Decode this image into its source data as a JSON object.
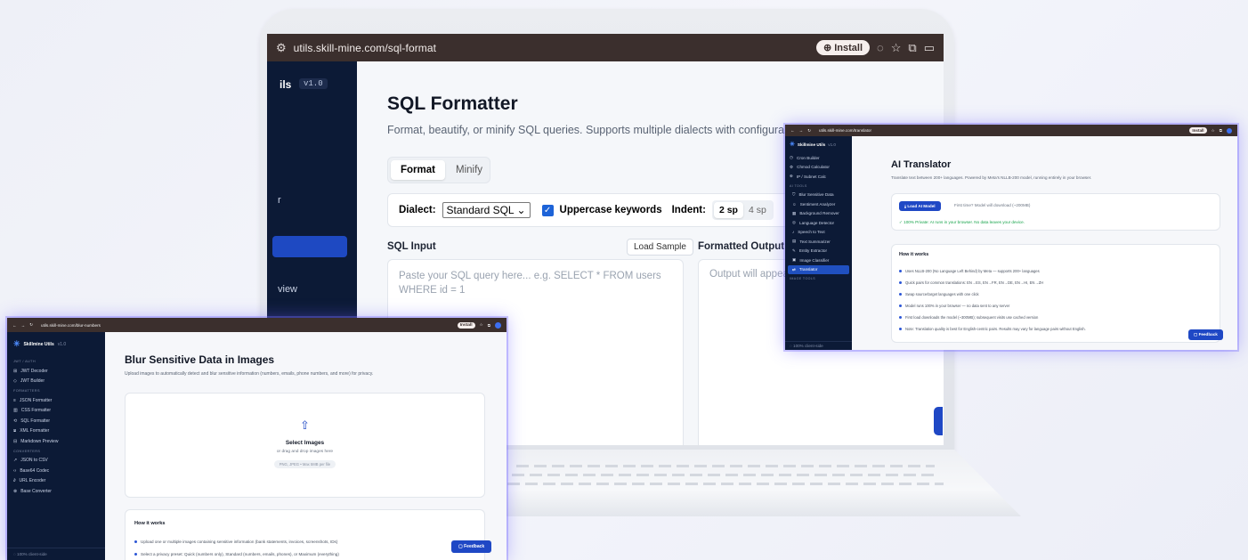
{
  "sql_screen": {
    "url": "utils.skill-mine.com/sql-format",
    "install_label": "Install",
    "version_badge": "v1.0",
    "brand_tail": "ils",
    "sidebar_partial": [
      "r",
      "view"
    ],
    "title": "SQL Formatter",
    "subtitle": "Format, beautify, or minify SQL queries. Supports multiple dialects with configurable key",
    "tabs": [
      "Format",
      "Minify"
    ],
    "dialect_label": "Dialect:",
    "dialect_value": "Standard SQL",
    "uppercase_label": "Uppercase keywords",
    "indent_label": "Indent:",
    "indent_options": [
      "2 sp",
      "4 sp"
    ],
    "input_label": "SQL Input",
    "load_sample_label": "Load Sample",
    "output_label": "Formatted Output",
    "input_placeholder": "Paste your SQL query here... e.g. SELECT * FROM users WHERE id = 1",
    "output_placeholder": "Output will appea"
  },
  "translator": {
    "url": "utils.skill-mine.com/translator",
    "install_label": "Install",
    "brand": "Skillmine Utils",
    "version": "v1.0",
    "sidebar_items_top": [
      "Cron Builder",
      "Chmod Calculator",
      "IP / Subnet Calc"
    ],
    "group_ai": "AI TOOLS",
    "ai_items": [
      "Blur Sensitive Data",
      "Sentiment Analyzer",
      "Background Remover",
      "Language Detector",
      "Speech to Text",
      "Text Summarizer",
      "Entity Extractor",
      "Image Classifier",
      "Translator"
    ],
    "group_image": "IMAGE TOOLS",
    "footer": "100% client-side",
    "title": "AI Translator",
    "subtitle": "Translate text between 200+ languages. Powered by Meta's NLLB-200 model, running entirely in your browser.",
    "load_button": "Load AI Model",
    "load_hint": "First time? Model will download (~200MB)",
    "privacy_note": "100% Private: AI runs in your browser. No data leaves your device.",
    "how_title": "How it works",
    "how_items": [
      "Uses NLLB-200 (No Language Left Behind) by Meta — supports 200+ languages",
      "Quick pairs for common translations: EN→ES, EN→FR, EN→DE, EN→HI, EN→ZH",
      "Swap source/target languages with one click",
      "Model runs 100% in your browser — no data sent to any server",
      "First load downloads the model (~300MB); subsequent visits use cached version",
      "Note: Translation quality is best for English-centric pairs. Results may vary for language pairs without English."
    ],
    "feedback": "Feedback"
  },
  "blur": {
    "url": "utils.skill-mine.com/blur-numbers",
    "install_label": "Install",
    "brand": "Skillmine Utils",
    "version": "v1.0",
    "groups": [
      {
        "name": "JWT / AUTH",
        "items": [
          "JWT Decoder",
          "JWT Builder"
        ]
      },
      {
        "name": "FORMATTERS",
        "items": [
          "JSON Formatter",
          "CSS Formatter",
          "SQL Formatter",
          "XML Formatter",
          "Markdown Preview"
        ]
      },
      {
        "name": "CONVERTERS",
        "items": [
          "JSON to CSV",
          "Base64 Codec",
          "URL Encoder",
          "Base Converter"
        ]
      }
    ],
    "footer": "100% client-side",
    "title": "Blur Sensitive Data in Images",
    "subtitle": "Upload images to automatically detect and blur sensitive information (numbers, emails, phone numbers, and more) for privacy.",
    "upload_title": "Select Images",
    "upload_hint": "or drag and drop images here",
    "upload_formats": "PNG, JPEG • Max 5MB per file",
    "how_title": "How it works",
    "how_items": [
      "Upload one or multiple images containing sensitive information (bank statements, invoices, screenshots, IDs)",
      "Select a privacy preset: Quick (numbers only), Standard (numbers, emails, phones), or Maximum (everything)"
    ],
    "feedback": "Feedback"
  },
  "colors": {
    "accent": "#1f48c5",
    "chrome": "#3b2f2d",
    "sidebar": "#0c1a36",
    "glow": "#6e64ff"
  }
}
